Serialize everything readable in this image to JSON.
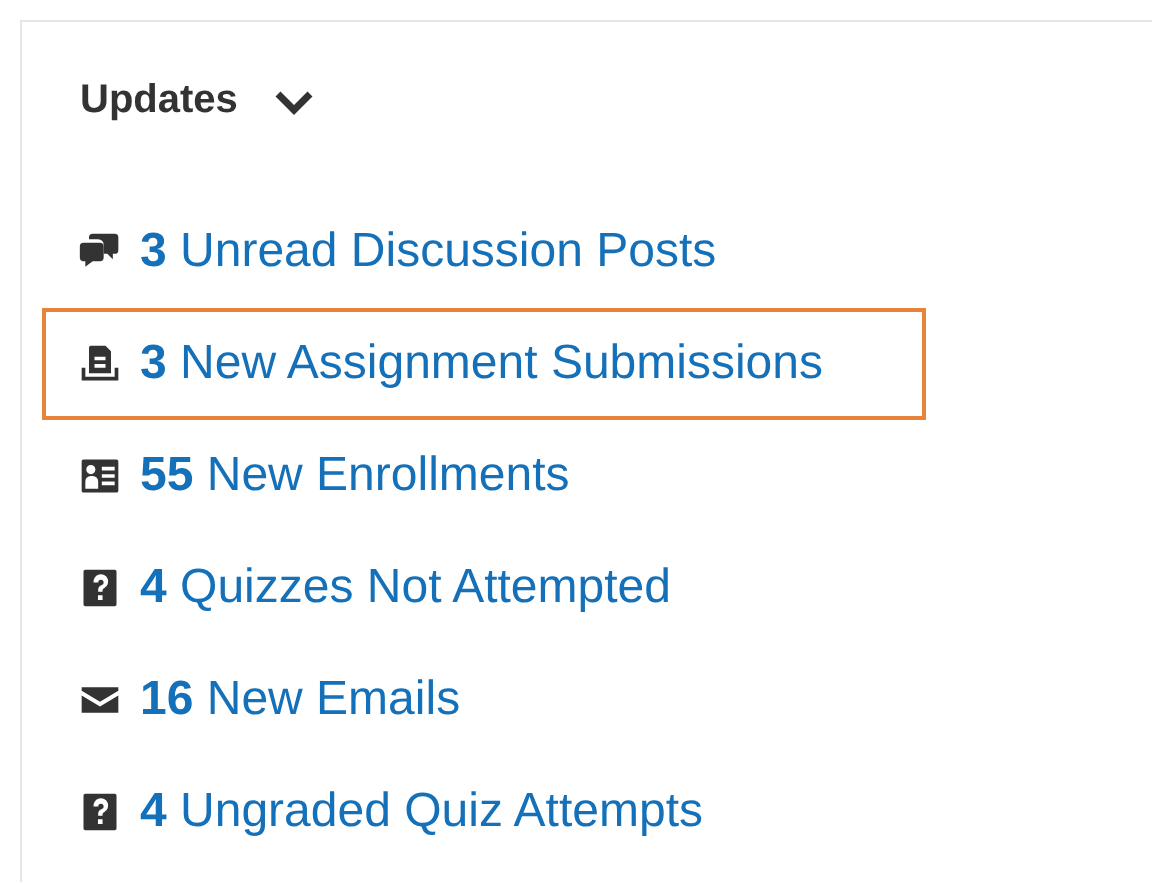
{
  "widget": {
    "title": "Updates",
    "expanded": true,
    "items": [
      {
        "kind": "discussion",
        "text": "**3** Unread Discussion Posts",
        "highlighted": false
      },
      {
        "kind": "assignment",
        "text": "**3** New Assignment Submissions",
        "highlighted": true
      },
      {
        "kind": "enrollment",
        "text": "**55** New Enrollments",
        "highlighted": false
      },
      {
        "kind": "quiz",
        "text": "**4** Quizzes Not Attempted",
        "highlighted": false
      },
      {
        "kind": "email",
        "text": "**16** New Emails",
        "highlighted": false
      },
      {
        "kind": "quiz",
        "text": "**4** Ungraded Quiz Attempts",
        "highlighted": false
      }
    ]
  }
}
